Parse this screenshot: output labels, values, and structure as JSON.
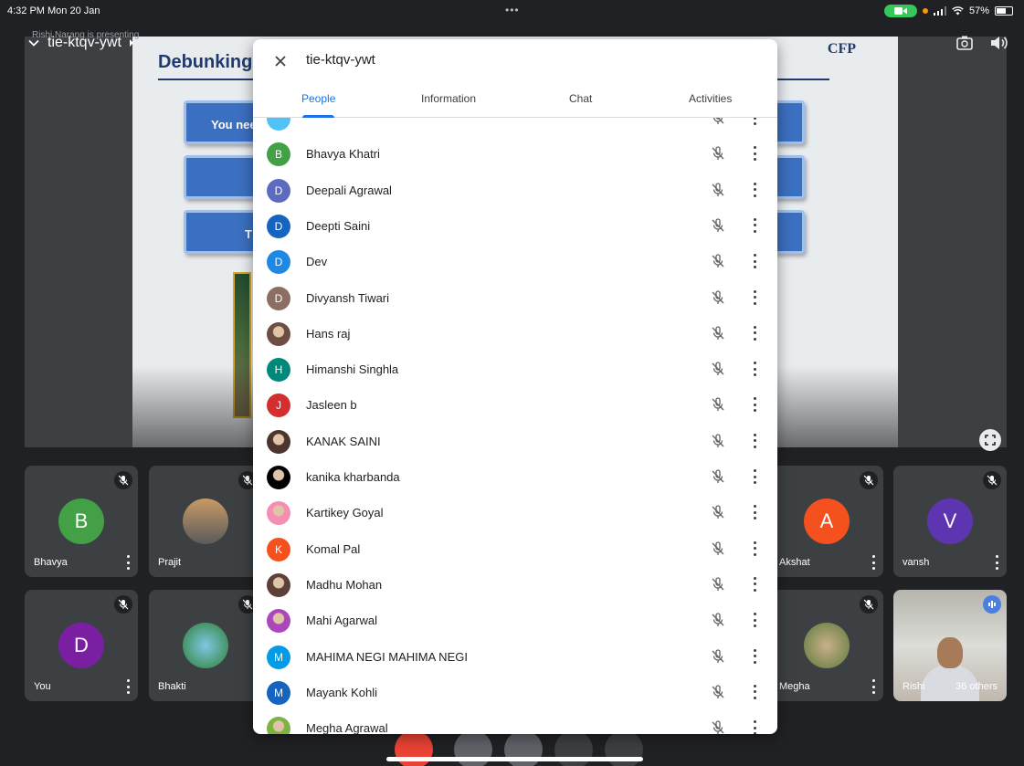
{
  "status_bar": {
    "time": "4:32 PM  Mon 20 Jan",
    "dots": "•••",
    "battery": "57%"
  },
  "meeting": {
    "presenting_label": "Rishi Narang is presenting",
    "code": "tie-ktqv-ywt"
  },
  "slide": {
    "title": "Debunking",
    "logo": "CFP",
    "box1_text": "You nee",
    "box3_text": "T"
  },
  "dialog": {
    "title": "tie-ktqv-ywt",
    "tabs": [
      "People",
      "Information",
      "Chat",
      "Activities"
    ],
    "active_tab": "People",
    "people": [
      {
        "name": "",
        "initial": "",
        "color": "#4fc3f7"
      },
      {
        "name": "Bhavya Khatri",
        "initial": "B",
        "color": "#43a047"
      },
      {
        "name": "Deepali Agrawal",
        "initial": "D",
        "color": "#5c6bc0"
      },
      {
        "name": "Deepti Saini",
        "initial": "D",
        "color": "#1565c0"
      },
      {
        "name": "Dev",
        "initial": "D",
        "color": "#1e88e5"
      },
      {
        "name": "Divyansh Tiwari",
        "initial": "D",
        "color": "#8d6e63"
      },
      {
        "name": "Hans raj",
        "initial": "",
        "color": "#6d4c41",
        "photo": true
      },
      {
        "name": "Himanshi Singhla",
        "initial": "H",
        "color": "#00897b"
      },
      {
        "name": "Jasleen b",
        "initial": "J",
        "color": "#d32f2f"
      },
      {
        "name": "KANAK SAINI",
        "initial": "",
        "color": "#4e342e",
        "photo": true
      },
      {
        "name": "kanika kharbanda",
        "initial": "",
        "color": "#000000",
        "photo": true
      },
      {
        "name": "Kartikey Goyal",
        "initial": "",
        "color": "#f48fb1",
        "photo": true
      },
      {
        "name": "Komal Pal",
        "initial": "K",
        "color": "#f4511e"
      },
      {
        "name": "Madhu Mohan",
        "initial": "",
        "color": "#5d4037",
        "photo": true
      },
      {
        "name": "Mahi Agarwal",
        "initial": "",
        "color": "#ab47bc",
        "photo": true
      },
      {
        "name": "MAHIMA NEGI MAHIMA NEGI",
        "initial": "M",
        "color": "#039be5"
      },
      {
        "name": "Mayank Kohli",
        "initial": "M",
        "color": "#1565c0"
      },
      {
        "name": "Megha Agrawal",
        "initial": "",
        "color": "#7cb342",
        "photo": true
      }
    ]
  },
  "tiles": [
    {
      "name": "Bhavya",
      "initial": "B",
      "color": "#43a047"
    },
    {
      "name": "Prajit",
      "initial": "",
      "color": "#6b6b6b",
      "photo": true
    },
    {
      "name": "Akshat",
      "initial": "A",
      "color": "#f4511e"
    },
    {
      "name": "vansh",
      "initial": "V",
      "color": "#5e35b1"
    },
    {
      "name": "You",
      "initial": "D",
      "color": "#7b1fa2"
    },
    {
      "name": "Bhakti",
      "initial": "",
      "color": "#2e7d32",
      "photo": true
    },
    {
      "name": "Megha",
      "initial": "",
      "color": "#8d9b5a",
      "photo": true
    },
    {
      "name": "Rishi",
      "others": "36 others"
    }
  ],
  "colors": {
    "accent": "#1a73e8",
    "background": "#202124",
    "tile": "#3c4043",
    "end_call": "#ea4335"
  }
}
